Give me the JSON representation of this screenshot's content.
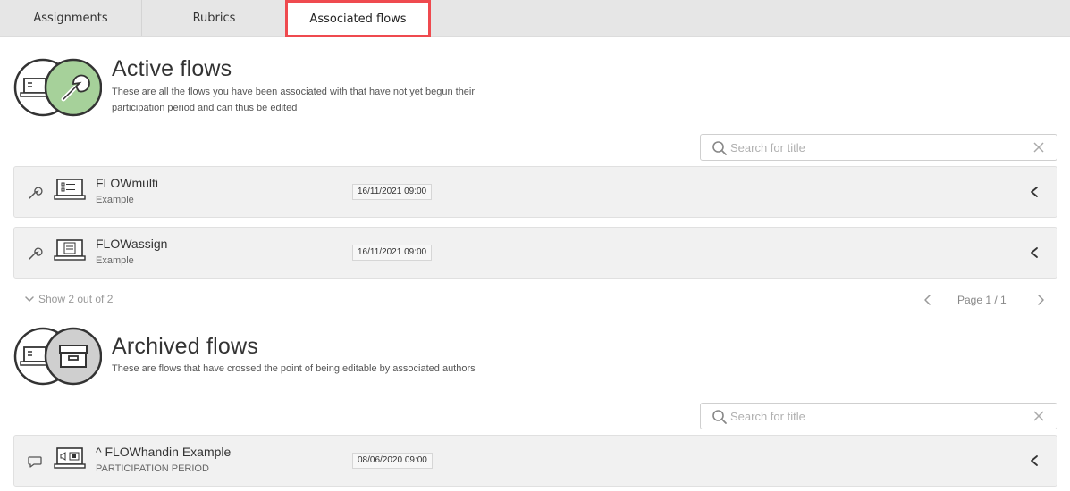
{
  "tabs": [
    {
      "label": "Assignments"
    },
    {
      "label": "Rubrics"
    },
    {
      "label": "Associated flows"
    }
  ],
  "active": {
    "title": "Active flows",
    "description": "These are all the flows you have been associated with that have not yet begun their participation period and can thus be edited",
    "search_placeholder": "Search for title",
    "rows": [
      {
        "name": "FLOWmulti",
        "subtitle": "Example",
        "date": "16/11/2021 09:00"
      },
      {
        "name": "FLOWassign",
        "subtitle": "Example",
        "date": "16/11/2021 09:00"
      }
    ],
    "show_label": "Show 2 out of 2",
    "page_label": "Page 1 / 1"
  },
  "archived": {
    "title": "Archived flows",
    "description": "These are flows that have crossed the point of being editable by associated authors",
    "search_placeholder": "Search for title",
    "rows": [
      {
        "name": "^ FLOWhandin Example",
        "subtitle": "PARTICIPATION PERIOD",
        "date": "08/06/2020 09:00"
      }
    ]
  },
  "colors": {
    "accent_tab_border": "#ef4a4f",
    "active_badge": "#a6d19a",
    "archived_badge": "#cfcfcf"
  },
  "icons": {
    "active_section": "laptop-wrench-icon",
    "archived_section": "laptop-archive-icon",
    "row_state_active": "wrench-icon",
    "row_state_archived": "comment-icon"
  }
}
